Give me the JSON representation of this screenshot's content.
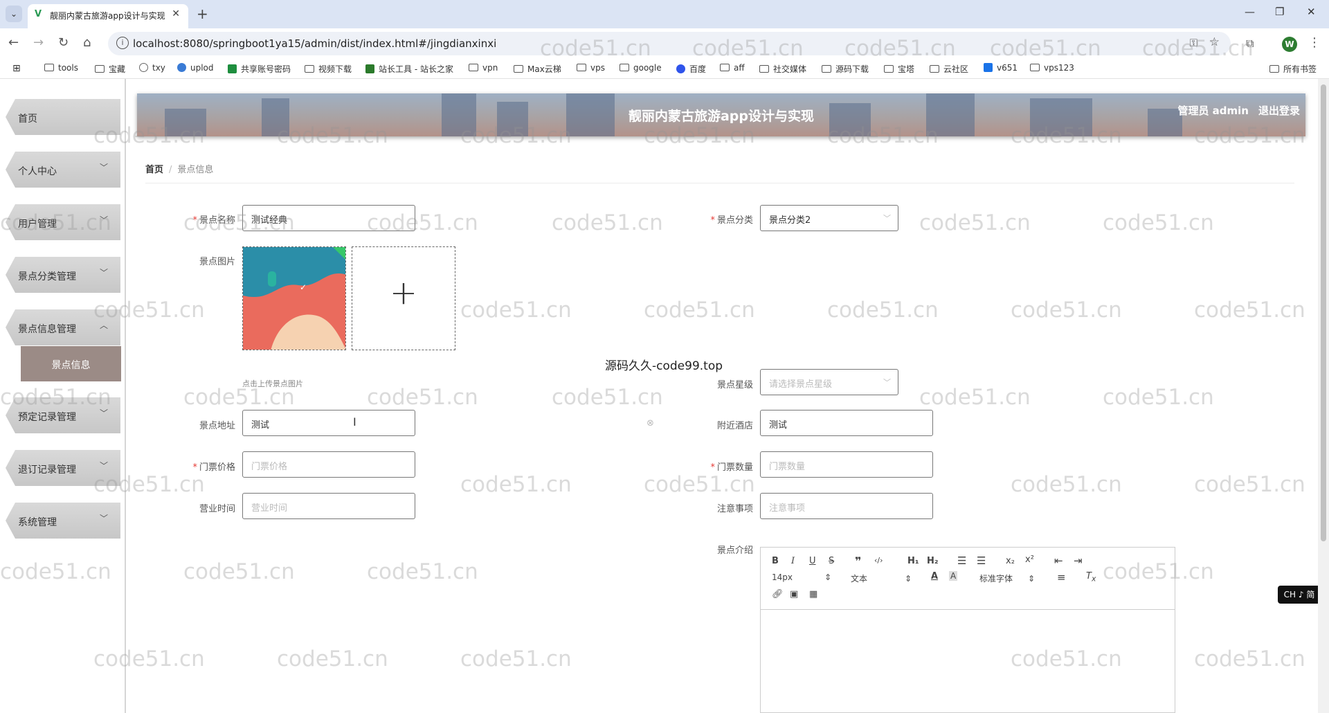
{
  "browser": {
    "tab_title": "靓丽内蒙古旅游app设计与实现",
    "url": "localhost:8080/springboot1ya15/admin/dist/index.html#/jingdianxinxi",
    "profile_initial": "W",
    "bookmarks": [
      "tools",
      "宝藏",
      "txy",
      "uplod",
      "共享账号密码",
      "视频下载",
      "站长工具 - 站长之家",
      "vpn",
      "Max云梯",
      "vps",
      "google",
      "百度",
      "aff",
      "社交媒体",
      "源码下载",
      "宝塔",
      "云社区",
      "v651",
      "vps123",
      "所有书签"
    ]
  },
  "sidebar": {
    "items": [
      {
        "label": "首页",
        "has_chevron": false
      },
      {
        "label": "个人中心",
        "has_chevron": true
      },
      {
        "label": "用户管理",
        "has_chevron": true
      },
      {
        "label": "景点分类管理",
        "has_chevron": true
      },
      {
        "label": "景点信息管理",
        "has_chevron": true,
        "expanded": true
      },
      {
        "label": "预定记录管理",
        "has_chevron": true
      },
      {
        "label": "退订记录管理",
        "has_chevron": true
      },
      {
        "label": "系统管理",
        "has_chevron": true
      }
    ],
    "submenu_label": "景点信息"
  },
  "header": {
    "title": "靓丽内蒙古旅游app设计与实现",
    "user": "管理员 admin",
    "logout": "退出登录"
  },
  "breadcrumb": {
    "home": "首页",
    "separator": "/",
    "current": "景点信息"
  },
  "form": {
    "name_label": "景点名称",
    "name_value": "测试经典",
    "category_label": "景点分类",
    "category_value": "景点分类2",
    "image_label": "景点图片",
    "upload_tip": "点击上传景点图片",
    "star_label": "景点星级",
    "star_placeholder": "请选择景点星级",
    "address_label": "景点地址",
    "address_value": "测试",
    "hotel_label": "附近酒店",
    "hotel_value": "测试",
    "price_label": "门票价格",
    "price_placeholder": "门票价格",
    "quantity_label": "门票数量",
    "quantity_placeholder": "门票数量",
    "hours_label": "营业时间",
    "hours_placeholder": "营业时间",
    "notes_label": "注意事项",
    "notes_placeholder": "注意事项",
    "intro_label": "景点介绍"
  },
  "editor": {
    "font_size": "14px",
    "text_type": "文本",
    "font_family": "标准字体"
  },
  "overlay_text": "源码久久-code99.top",
  "ime_label": "CH ♪ 简",
  "watermark": "code51.cn"
}
